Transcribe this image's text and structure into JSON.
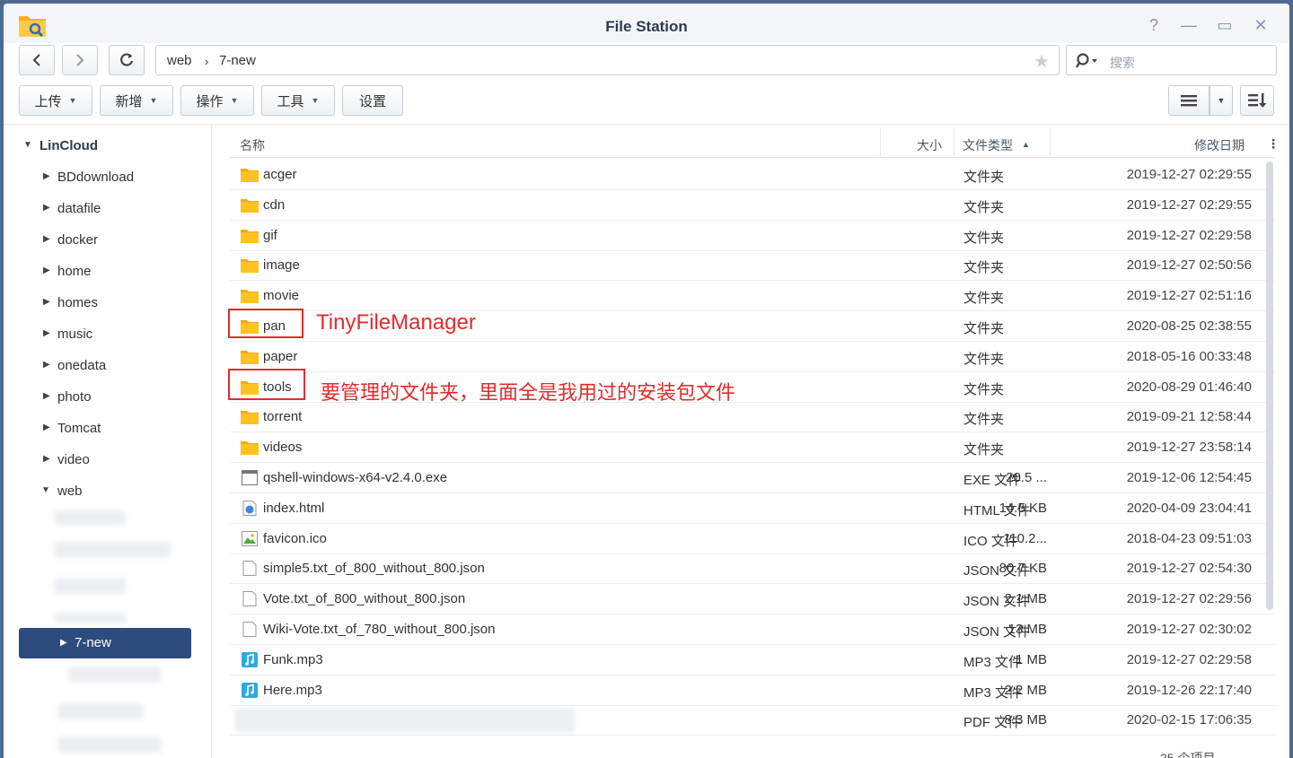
{
  "window": {
    "title": "File Station"
  },
  "toolbar": {
    "path": [
      "web",
      "7-new"
    ],
    "search_placeholder": "搜索",
    "upload": "上传",
    "create": "新增",
    "action": "操作",
    "tools": "工具",
    "settings": "设置"
  },
  "sidebar": {
    "root": "LinCloud",
    "items": [
      "BDdownload",
      "datafile",
      "docker",
      "home",
      "homes",
      "music",
      "onedata",
      "photo",
      "Tomcat",
      "video",
      "web"
    ],
    "selected": "7-new"
  },
  "columns": {
    "name": "名称",
    "size": "大小",
    "type": "文件类型",
    "modified": "修改日期"
  },
  "files": [
    {
      "name": "acger",
      "size": "",
      "type": "文件夹",
      "date": "2019-12-27 02:29:55",
      "icon": "folder-icon"
    },
    {
      "name": "cdn",
      "size": "",
      "type": "文件夹",
      "date": "2019-12-27 02:29:55",
      "icon": "folder-icon"
    },
    {
      "name": "gif",
      "size": "",
      "type": "文件夹",
      "date": "2019-12-27 02:29:58",
      "icon": "folder-icon"
    },
    {
      "name": "image",
      "size": "",
      "type": "文件夹",
      "date": "2019-12-27 02:50:56",
      "icon": "folder-icon"
    },
    {
      "name": "movie",
      "size": "",
      "type": "文件夹",
      "date": "2019-12-27 02:51:16",
      "icon": "folder-icon"
    },
    {
      "name": "pan",
      "size": "",
      "type": "文件夹",
      "date": "2020-08-25 02:38:55",
      "icon": "folder-icon"
    },
    {
      "name": "paper",
      "size": "",
      "type": "文件夹",
      "date": "2018-05-16 00:33:48",
      "icon": "folder-icon"
    },
    {
      "name": "tools",
      "size": "",
      "type": "文件夹",
      "date": "2020-08-29 01:46:40",
      "icon": "folder-icon"
    },
    {
      "name": "torrent",
      "size": "",
      "type": "文件夹",
      "date": "2019-09-21 12:58:44",
      "icon": "folder-icon"
    },
    {
      "name": "videos",
      "size": "",
      "type": "文件夹",
      "date": "2019-12-27 23:58:14",
      "icon": "folder-icon"
    },
    {
      "name": "qshell-windows-x64-v2.4.0.exe",
      "size": "20.5 ...",
      "type": "EXE 文件",
      "date": "2019-12-06 12:54:45",
      "icon": "exe-icon"
    },
    {
      "name": "index.html",
      "size": "14.5 KB",
      "type": "HTML 文件",
      "date": "2020-04-09 23:04:41",
      "icon": "html-icon"
    },
    {
      "name": "favicon.ico",
      "size": "110.2...",
      "type": "ICO 文件",
      "date": "2018-04-23 09:51:03",
      "icon": "image-icon"
    },
    {
      "name": "simple5.txt_of_800_without_800.json",
      "size": "80.7 KB",
      "type": "JSON 文件",
      "date": "2019-12-27 02:54:30",
      "icon": "file-icon"
    },
    {
      "name": "Vote.txt_of_800_without_800.json",
      "size": "2.1 MB",
      "type": "JSON 文件",
      "date": "2019-12-27 02:29:56",
      "icon": "file-icon"
    },
    {
      "name": "Wiki-Vote.txt_of_780_without_800.json",
      "size": "13 MB",
      "type": "JSON 文件",
      "date": "2019-12-27 02:30:02",
      "icon": "file-icon"
    },
    {
      "name": "Funk.mp3",
      "size": "1 MB",
      "type": "MP3 文件",
      "date": "2019-12-27 02:29:58",
      "icon": "music-icon"
    },
    {
      "name": "Here.mp3",
      "size": "2.2 MB",
      "type": "MP3 文件",
      "date": "2019-12-26 22:17:40",
      "icon": "music-icon"
    },
    {
      "name": "",
      "size": "8.3 MB",
      "type": "PDF 文件",
      "date": "2020-02-15 17:06:35",
      "icon": "pdf-icon"
    }
  ],
  "annotations": {
    "pan_note": "TinyFileManager",
    "tools_note": "要管理的文件夹，里面全是我用过的安装包文件"
  },
  "footer": {
    "item_count": "25 个项目"
  }
}
